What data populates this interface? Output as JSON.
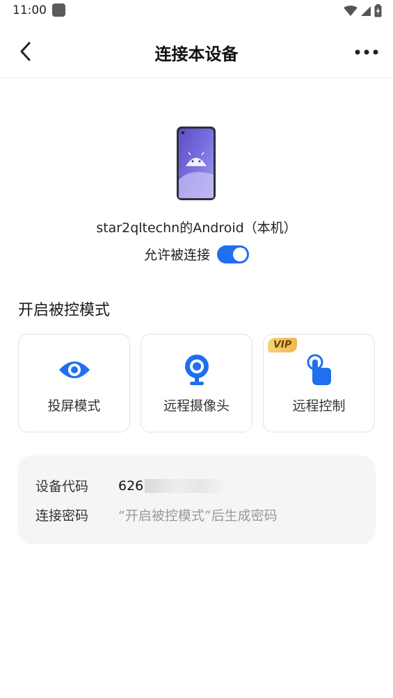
{
  "status_bar": {
    "time": "11:00"
  },
  "header": {
    "title": "连接本设备"
  },
  "device": {
    "name": "star2qltechn的Android（本机）",
    "allow_label": "允许被连接",
    "allow_enabled": true
  },
  "modes": {
    "section_title": "开启被控模式",
    "items": [
      {
        "label": "投屏模式",
        "icon": "eye-icon"
      },
      {
        "label": "远程摄像头",
        "icon": "webcam-icon"
      },
      {
        "label": "远程控制",
        "icon": "touch-hand-icon",
        "badge": "VIP"
      }
    ]
  },
  "info": {
    "device_code_label": "设备代码",
    "device_code_value": "626",
    "password_label": "连接密码",
    "password_hint": "“开启被控模式”后生成密码"
  },
  "colors": {
    "accent": "#1f6ff0",
    "vip": "#efb74a"
  }
}
